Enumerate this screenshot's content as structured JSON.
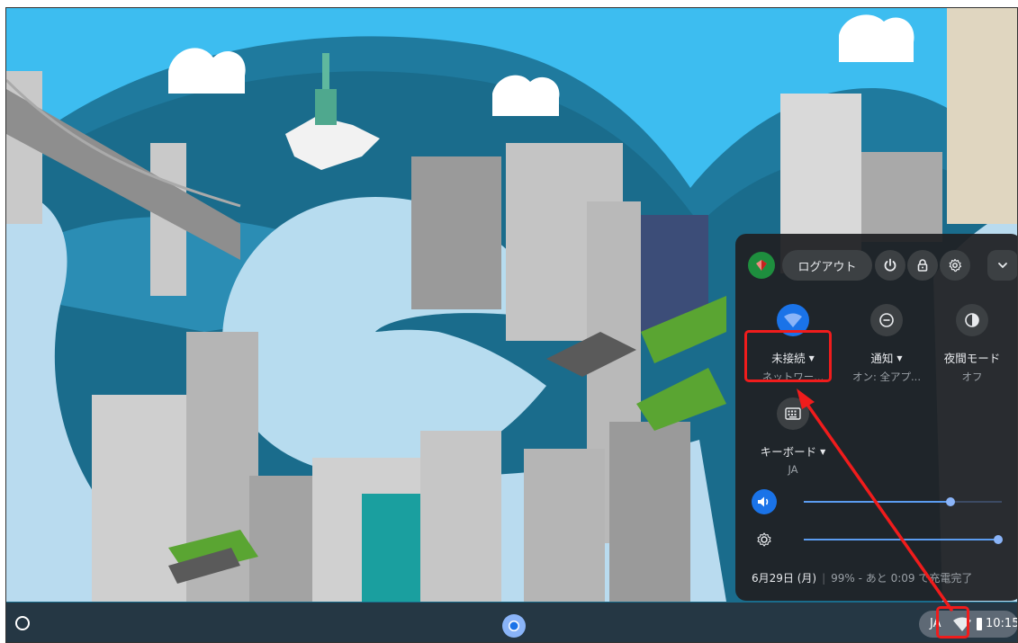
{
  "quick_settings": {
    "logout_label": "ログアウト",
    "network": {
      "label": "未接続",
      "status": "ネットワー..."
    },
    "notifications": {
      "label": "通知",
      "status": "オン: 全アプ..."
    },
    "night_light": {
      "label": "夜間モード",
      "status": "オフ"
    },
    "keyboard": {
      "label": "キーボード",
      "status": "JA"
    },
    "volume_level": 0.74,
    "brightness_level": 0.98,
    "date": "6月29日 (月)",
    "battery_status": "99% - あと 0:09 で充電完了"
  },
  "shelf": {
    "ime_indicator": "JA",
    "clock": "10:15"
  },
  "colors": {
    "accent": "#1a73e8",
    "panel_bg": "#202124",
    "annotation": "#f01c1c"
  },
  "icons": {
    "avatar": "avatar-icon",
    "power": "power-icon",
    "lock": "lock-icon",
    "settings": "gear-icon",
    "collapse": "chevron-down-icon",
    "wifi": "wifi-icon",
    "notifications": "do-not-disturb-icon",
    "night_light": "night-light-icon",
    "keyboard": "keyboard-icon",
    "volume": "volume-icon",
    "brightness": "brightness-icon",
    "launcher": "launcher-icon",
    "browser": "chrome-icon"
  }
}
